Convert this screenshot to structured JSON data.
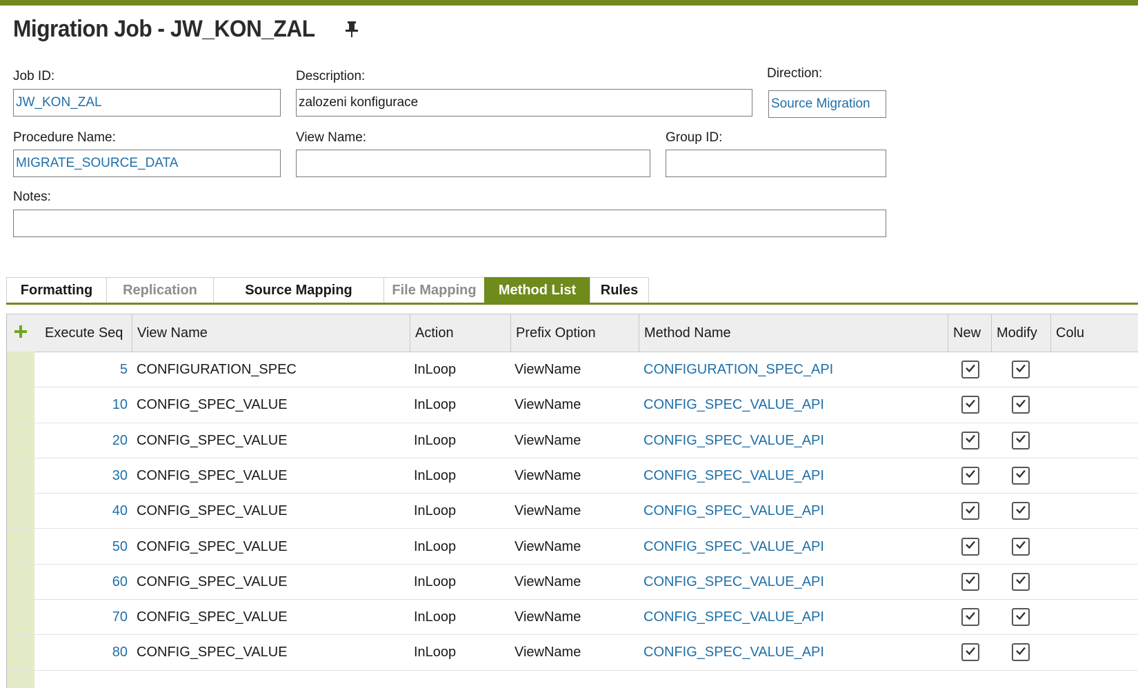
{
  "page": {
    "title": "Migration Job - JW_KON_ZAL",
    "colors": {
      "accent": "#6f8b1c",
      "link": "#1f6fa8",
      "row_gutter": "#e3ecc7"
    }
  },
  "form": {
    "job_id": {
      "label": "Job ID:",
      "value": "JW_KON_ZAL"
    },
    "description": {
      "label": "Description:",
      "value": "zalozeni konfigurace"
    },
    "direction": {
      "label": "Direction:",
      "value": "Source Migration"
    },
    "procedure_name": {
      "label": "Procedure Name:",
      "value": "MIGRATE_SOURCE_DATA"
    },
    "view_name": {
      "label": "View Name:",
      "value": ""
    },
    "group_id": {
      "label": "Group ID:",
      "value": ""
    },
    "notes": {
      "label": "Notes:",
      "value": ""
    }
  },
  "tabs": [
    {
      "label": "Formatting",
      "state": "normal"
    },
    {
      "label": "Replication",
      "state": "disabled"
    },
    {
      "label": "Source Mapping",
      "state": "normal"
    },
    {
      "label": "File Mapping",
      "state": "disabled"
    },
    {
      "label": "Method List",
      "state": "active"
    },
    {
      "label": "Rules",
      "state": "normal"
    }
  ],
  "grid": {
    "add_icon": "plus-icon",
    "columns": [
      "Execute Seq",
      "View Name",
      "Action",
      "Prefix Option",
      "Method Name",
      "New",
      "Modify",
      "Colu"
    ],
    "rows": [
      {
        "seq": "5",
        "view": "CONFIGURATION_SPEC",
        "action": "InLoop",
        "prefix": "ViewName",
        "method": "CONFIGURATION_SPEC_API",
        "new": true,
        "modify": true
      },
      {
        "seq": "10",
        "view": "CONFIG_SPEC_VALUE",
        "action": "InLoop",
        "prefix": "ViewName",
        "method": "CONFIG_SPEC_VALUE_API",
        "new": true,
        "modify": true
      },
      {
        "seq": "20",
        "view": "CONFIG_SPEC_VALUE",
        "action": "InLoop",
        "prefix": "ViewName",
        "method": "CONFIG_SPEC_VALUE_API",
        "new": true,
        "modify": true
      },
      {
        "seq": "30",
        "view": "CONFIG_SPEC_VALUE",
        "action": "InLoop",
        "prefix": "ViewName",
        "method": "CONFIG_SPEC_VALUE_API",
        "new": true,
        "modify": true
      },
      {
        "seq": "40",
        "view": "CONFIG_SPEC_VALUE",
        "action": "InLoop",
        "prefix": "ViewName",
        "method": "CONFIG_SPEC_VALUE_API",
        "new": true,
        "modify": true
      },
      {
        "seq": "50",
        "view": "CONFIG_SPEC_VALUE",
        "action": "InLoop",
        "prefix": "ViewName",
        "method": "CONFIG_SPEC_VALUE_API",
        "new": true,
        "modify": true
      },
      {
        "seq": "60",
        "view": "CONFIG_SPEC_VALUE",
        "action": "InLoop",
        "prefix": "ViewName",
        "method": "CONFIG_SPEC_VALUE_API",
        "new": true,
        "modify": true
      },
      {
        "seq": "70",
        "view": "CONFIG_SPEC_VALUE",
        "action": "InLoop",
        "prefix": "ViewName",
        "method": "CONFIG_SPEC_VALUE_API",
        "new": true,
        "modify": true
      },
      {
        "seq": "80",
        "view": "CONFIG_SPEC_VALUE",
        "action": "InLoop",
        "prefix": "ViewName",
        "method": "CONFIG_SPEC_VALUE_API",
        "new": true,
        "modify": true
      }
    ]
  }
}
